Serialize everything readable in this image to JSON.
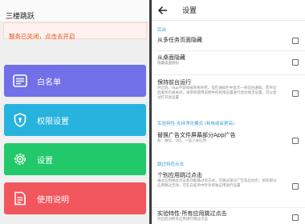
{
  "app": {
    "title": "三楼跳跃"
  },
  "banner": {
    "text": "服务已关闭，点击去开启"
  },
  "menu": [
    {
      "label": "白名单",
      "icon": "list-icon",
      "color": "#7170e8"
    },
    {
      "label": "权限设置",
      "icon": "shield-icon",
      "color": "#28b3df"
    },
    {
      "label": "设置",
      "icon": "gear-icon",
      "color": "#21c96b"
    },
    {
      "label": "使用说明",
      "icon": "document-icon",
      "color": "#f2565d"
    }
  ],
  "settings": {
    "title": "设置",
    "back_icon": "back-arrow-icon",
    "sections": [
      {
        "label": "后台"
      },
      {
        "label": "实验特性-支持净化模式 (耗电或会更高)"
      },
      {
        "label": "跳过特色点击"
      }
    ],
    "items": [
      {
        "title": "从多任务页面隐藏",
        "summary": "",
        "checked": false
      },
      {
        "title": "从桌面隐藏",
        "summary": "隐藏桌面图标",
        "checked": false
      },
      {
        "title": "保持前台运行",
        "summary": "开启后，App不容易被系统杀死，但在通知栏中显示一条前台通知。若开启后服务仍被关闭，请参照使用说明中的权限设置进行后台保活设置，可以尝试打开此设置",
        "checked": false
      },
      {
        "title": "替换广告文件屏幕部分App广告",
        "summary": "如：微信、QQ、一些小米应用",
        "checked": false
      },
      {
        "title": "个别应用跳过点击",
        "summary": "通过应用跳过点击和功能跳过的方式，可跳过部分广告及启动页；如有部分应用跳过无效，可在白名单中针对单独应用进行设置",
        "checked": false
      },
      {
        "title": "实验特性-所有应用跳过点击",
        "summary": "开启后对所有应用进行跳过点击",
        "checked": false
      }
    ]
  },
  "colors": {
    "accent": "#3a9fd9",
    "banner_text": "#e0521f",
    "banner_bg": "#fff1ee"
  }
}
